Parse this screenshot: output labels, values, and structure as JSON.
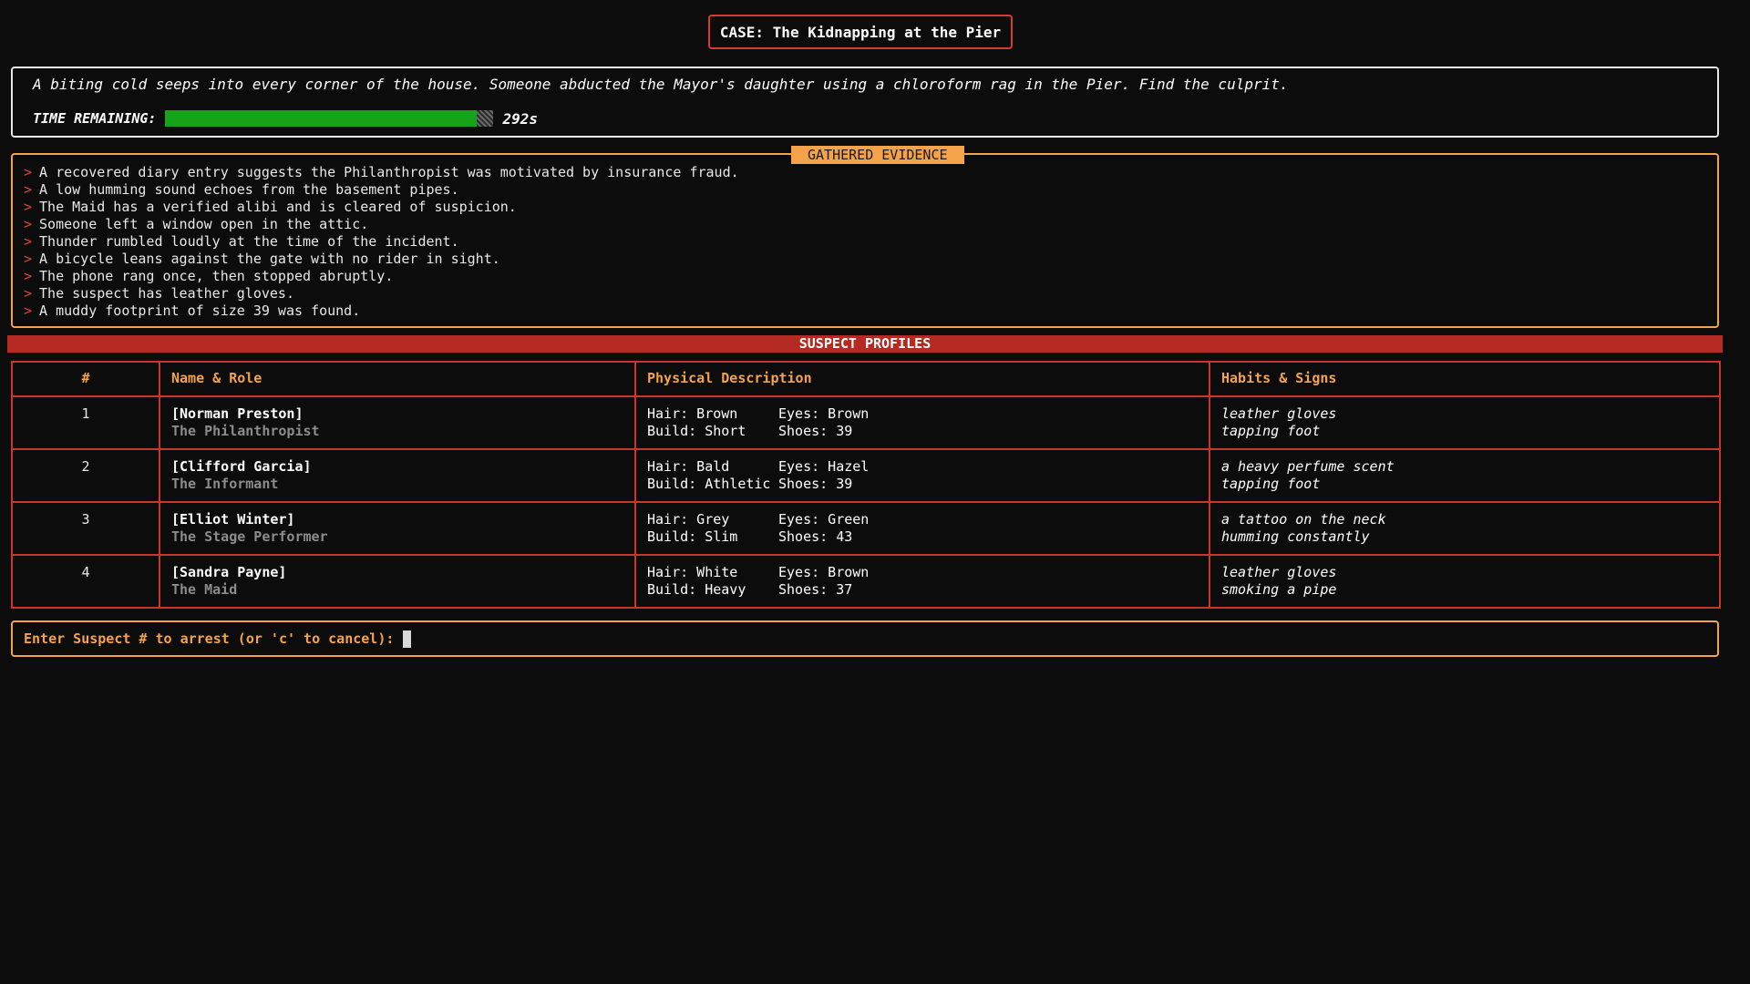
{
  "case": {
    "title": "CASE: The Kidnapping at the Pier"
  },
  "intro": {
    "text": "A biting cold seeps into every corner of the house. Someone abducted the Mayor's daughter using a chloroform rag in the Pier. Find the culprit.",
    "timer_label": "TIME REMAINING:",
    "timer_value": "292s",
    "timer_fraction": 0.95,
    "timer_color": "#16a31a"
  },
  "evidence": {
    "title": "GATHERED EVIDENCE",
    "marker": ">",
    "items": [
      "A recovered diary entry suggests the Philanthropist was motivated by insurance fraud.",
      "A low humming sound echoes from the basement pipes.",
      "The Maid has a verified alibi and is cleared of suspicion.",
      "Someone left a window open in the attic.",
      "Thunder rumbled loudly at the time of the incident.",
      "A bicycle leans against the gate with no rider in sight.",
      "The phone rang once, then stopped abruptly.",
      "The suspect has leather gloves.",
      "A muddy footprint of size 39 was found."
    ]
  },
  "suspects": {
    "banner": "SUSPECT PROFILES",
    "headers": [
      "#",
      "Name & Role",
      "Physical Description",
      "Habits & Signs"
    ],
    "rows": [
      {
        "num": "1",
        "name": "[Norman Preston]",
        "role": "The Philanthropist",
        "hair": "Hair: Brown",
        "eyes": "Eyes: Brown",
        "build": "Build: Short",
        "shoes": "Shoes: 39",
        "habits": [
          "leather gloves",
          "tapping foot"
        ]
      },
      {
        "num": "2",
        "name": "[Clifford Garcia]",
        "role": "The Informant",
        "hair": "Hair: Bald",
        "eyes": "Eyes: Hazel",
        "build": "Build: Athletic",
        "shoes": "Shoes: 39",
        "habits": [
          "a heavy perfume scent",
          "tapping foot"
        ]
      },
      {
        "num": "3",
        "name": "[Elliot Winter]",
        "role": "The Stage Performer",
        "hair": "Hair: Grey",
        "eyes": "Eyes: Green",
        "build": "Build: Slim",
        "shoes": "Shoes: 43",
        "habits": [
          "a tattoo on the neck",
          "humming constantly"
        ]
      },
      {
        "num": "4",
        "name": "[Sandra Payne]",
        "role": "The Maid",
        "hair": "Hair: White",
        "eyes": "Eyes: Brown",
        "build": "Build: Heavy",
        "shoes": "Shoes: 37",
        "habits": [
          "leather gloves",
          "smoking a pipe"
        ]
      }
    ]
  },
  "prompt": {
    "label": "Enter Suspect # to arrest (or 'c' to cancel):",
    "value": ""
  }
}
